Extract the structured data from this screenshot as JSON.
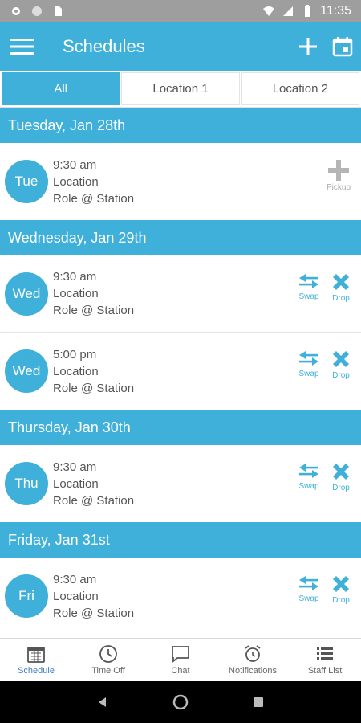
{
  "status_bar": {
    "time": "11:35"
  },
  "app_bar": {
    "title": "Schedules"
  },
  "tabs": [
    {
      "label": "All",
      "active": true
    },
    {
      "label": "Location 1",
      "active": false
    },
    {
      "label": "Location 2",
      "active": false
    }
  ],
  "days": [
    {
      "header": "Tuesday, Jan 28th",
      "shifts": [
        {
          "day": "Tue",
          "time": "9:30 am",
          "location": "Location",
          "role": "Role @ Station",
          "actions": [
            "Pickup"
          ]
        }
      ]
    },
    {
      "header": "Wednesday, Jan 29th",
      "shifts": [
        {
          "day": "Wed",
          "time": "9:30 am",
          "location": "Location",
          "role": "Role @ Station",
          "actions": [
            "Swap",
            "Drop"
          ]
        },
        {
          "day": "Wed",
          "time": "5:00 pm",
          "location": "Location",
          "role": "Role @ Station",
          "actions": [
            "Swap",
            "Drop"
          ]
        }
      ]
    },
    {
      "header": "Thursday, Jan 30th",
      "shifts": [
        {
          "day": "Thu",
          "time": "9:30 am",
          "location": "Location",
          "role": "Role @ Station",
          "actions": [
            "Swap",
            "Drop"
          ]
        }
      ]
    },
    {
      "header": "Friday, Jan 31st",
      "shifts": [
        {
          "day": "Fri",
          "time": "9:30 am",
          "location": "Location",
          "role": "Role @ Station",
          "actions": [
            "Swap",
            "Drop"
          ]
        }
      ]
    }
  ],
  "bottom_nav": [
    {
      "label": "Schedule",
      "icon": "calendar-icon",
      "active": true
    },
    {
      "label": "Time Off",
      "icon": "clock-icon",
      "active": false
    },
    {
      "label": "Chat",
      "icon": "chat-icon",
      "active": false
    },
    {
      "label": "Notifications",
      "icon": "alarm-icon",
      "active": false
    },
    {
      "label": "Staff List",
      "icon": "list-icon",
      "active": false
    }
  ],
  "colors": {
    "accent": "#3fb0da",
    "active_nav": "#3f7fc0",
    "pickup_gray": "#aaaaaa"
  }
}
